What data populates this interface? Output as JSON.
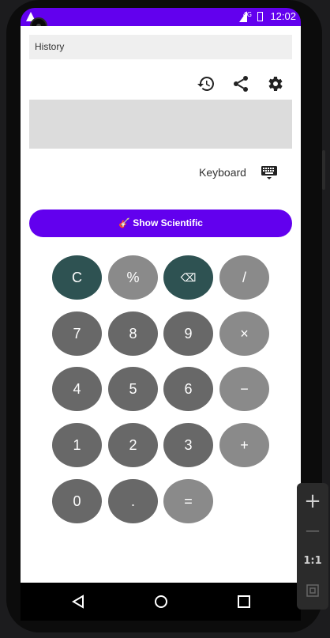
{
  "status_bar": {
    "time": "12:02",
    "network": "4G"
  },
  "history": {
    "label": "History"
  },
  "toolbar": {
    "history_icon": "history-icon",
    "share_icon": "share-icon",
    "settings_icon": "gear-icon"
  },
  "keyboard": {
    "label": "Keyboard",
    "icon": "keyboard-icon"
  },
  "scientific": {
    "label": "🎸 Show Scientific"
  },
  "keys": {
    "clear": "C",
    "percent": "%",
    "backspace": "⌫",
    "divide": "/",
    "seven": "7",
    "eight": "8",
    "nine": "9",
    "multiply": "×",
    "four": "4",
    "five": "5",
    "six": "6",
    "minus": "−",
    "one": "1",
    "two": "2",
    "three": "3",
    "plus": "+",
    "zero": "0",
    "dot": ".",
    "equals": "="
  },
  "zoom_controls": {
    "plus": "+",
    "minus": "—",
    "ratio": "1:1"
  },
  "colors": {
    "accent": "#6200ee",
    "dark_key": "#2e5252",
    "number_key": "#686868",
    "op_key": "#8a8a8a"
  }
}
